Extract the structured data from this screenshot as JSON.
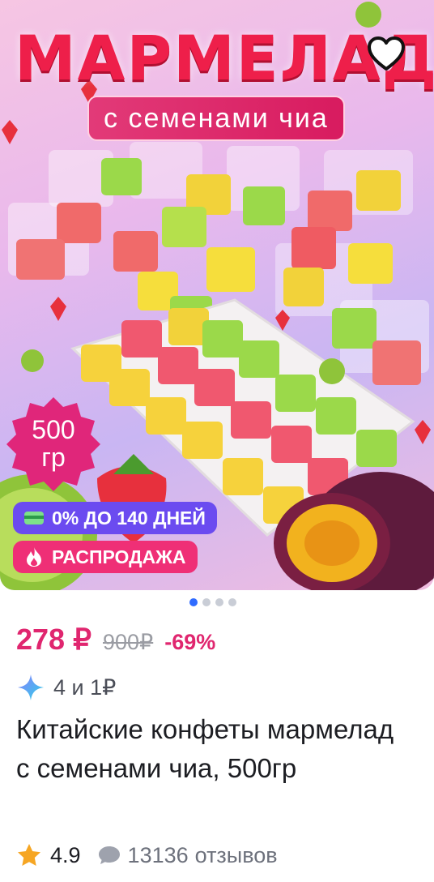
{
  "product_image": {
    "headline": "МАРМЕЛАД",
    "subheadline": "с семенами чиа",
    "weight_value": "500",
    "weight_unit": "гр",
    "carousel_total": 4,
    "carousel_active": 1
  },
  "promo_badges": {
    "installment": "0% ДО 140 ДНЕЙ",
    "sale": "РАСПРОДАЖА"
  },
  "price": {
    "current": "278 ₽",
    "old": "900₽",
    "discount": "-69%"
  },
  "bonus": {
    "text": "4 и 1₽"
  },
  "product": {
    "title": "Китайские конфеты мармелад с семенами чиа, 500гр"
  },
  "rating": {
    "value": "4.9",
    "reviews_count": "13136",
    "reviews_label": "отзывов"
  },
  "colors": {
    "price": "#e0266f",
    "headline": "#ee1f4a",
    "installment_badge": "#6b4bf0",
    "sale_badge": "#ef2f76",
    "active_dot": "#2f6bff",
    "star": "#f6a623"
  }
}
